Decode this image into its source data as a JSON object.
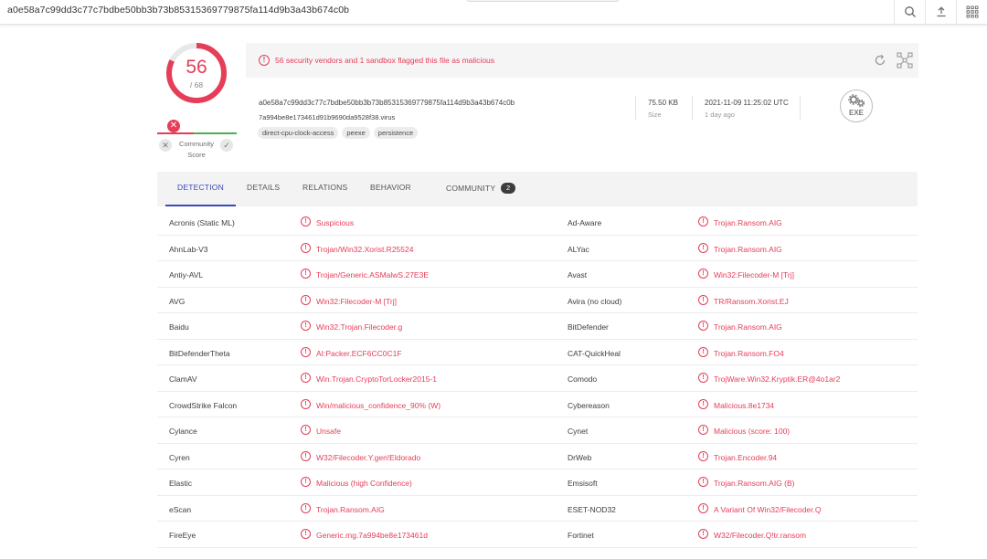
{
  "search": {
    "value": "a0e58a7c99dd3c77c7bdbe50bb3b73b85315369779875fa114d9b3a43b674c0b"
  },
  "top_actions": [
    {
      "icon": "search-icon"
    },
    {
      "icon": "upload-icon"
    },
    {
      "icon": "apps-grid-icon"
    }
  ],
  "score": {
    "value": "56",
    "total": "/ 68",
    "ring_fraction": 0.8235
  },
  "community": {
    "label_line1": "Community",
    "label_line2": "Score",
    "vote_down": "✕",
    "vote_up": "✓",
    "marker": "✕"
  },
  "alert": {
    "icon": "!",
    "text": "56 security vendors and 1 sandbox flagged this file as malicious"
  },
  "file": {
    "hash": "a0e58a7c99dd3c77c7bdbe50bb3b73b85315369779875fa114d9b3a43b674c0b",
    "name": "7a994be8e173461d91b9690da9528f38.virus",
    "tags": [
      "direct-cpu-clock-access",
      "peexe",
      "persistence"
    ],
    "size_value": "75.50 KB",
    "size_label": "Size",
    "date_value": "2021-11-09 11:25:02 UTC",
    "date_label": "1 day ago",
    "type_label": "EXE"
  },
  "tabs": [
    {
      "label": "DETECTION",
      "active": true
    },
    {
      "label": "DETAILS"
    },
    {
      "label": "RELATIONS"
    },
    {
      "label": "BEHAVIOR"
    },
    {
      "label": "COMMUNITY",
      "badge": "2"
    }
  ],
  "detections": [
    [
      {
        "vendor": "Acronis (Static ML)",
        "result": "Suspicious"
      },
      {
        "vendor": "Ad-Aware",
        "result": "Trojan.Ransom.AIG"
      }
    ],
    [
      {
        "vendor": "AhnLab-V3",
        "result": "Trojan/Win32.Xorist.R25524"
      },
      {
        "vendor": "ALYac",
        "result": "Trojan.Ransom.AIG"
      }
    ],
    [
      {
        "vendor": "Antiy-AVL",
        "result": "Trojan/Generic.ASMalwS.27E3E"
      },
      {
        "vendor": "Avast",
        "result": "Win32:Filecoder-M [Trj]"
      }
    ],
    [
      {
        "vendor": "AVG",
        "result": "Win32:Filecoder-M [Trj]"
      },
      {
        "vendor": "Avira (no cloud)",
        "result": "TR/Ransom.Xorist.EJ"
      }
    ],
    [
      {
        "vendor": "Baidu",
        "result": "Win32.Trojan.Filecoder.g"
      },
      {
        "vendor": "BitDefender",
        "result": "Trojan.Ransom.AIG"
      }
    ],
    [
      {
        "vendor": "BitDefenderTheta",
        "result": "AI:Packer.ECF6CC0C1F"
      },
      {
        "vendor": "CAT-QuickHeal",
        "result": "Trojan.Ransom.FO4"
      }
    ],
    [
      {
        "vendor": "ClamAV",
        "result": "Win.Trojan.CryptoTorLocker2015-1"
      },
      {
        "vendor": "Comodo",
        "result": "TrojWare.Win32.Kryptik.ER@4o1ar2"
      }
    ],
    [
      {
        "vendor": "CrowdStrike Falcon",
        "result": "Win/malicious_confidence_90% (W)"
      },
      {
        "vendor": "Cybereason",
        "result": "Malicious.8e1734"
      }
    ],
    [
      {
        "vendor": "Cylance",
        "result": "Unsafe"
      },
      {
        "vendor": "Cynet",
        "result": "Malicious (score: 100)"
      }
    ],
    [
      {
        "vendor": "Cyren",
        "result": "W32/Filecoder.Y.gen!Eldorado"
      },
      {
        "vendor": "DrWeb",
        "result": "Trojan.Encoder.94"
      }
    ],
    [
      {
        "vendor": "Elastic",
        "result": "Malicious (high Confidence)"
      },
      {
        "vendor": "Emsisoft",
        "result": "Trojan.Ransom.AIG (B)"
      }
    ],
    [
      {
        "vendor": "eScan",
        "result": "Trojan.Ransom.AIG"
      },
      {
        "vendor": "ESET-NOD32",
        "result": "A Variant Of Win32/Filecoder.Q"
      }
    ],
    [
      {
        "vendor": "FireEye",
        "result": "Generic.mg.7a994be8e173461d"
      },
      {
        "vendor": "Fortinet",
        "result": "W32/Filecoder.Q!tr.ransom"
      }
    ]
  ],
  "colors": {
    "accent": "#3b49bd",
    "danger": "#e63d58",
    "community_green": "#4caf50"
  }
}
